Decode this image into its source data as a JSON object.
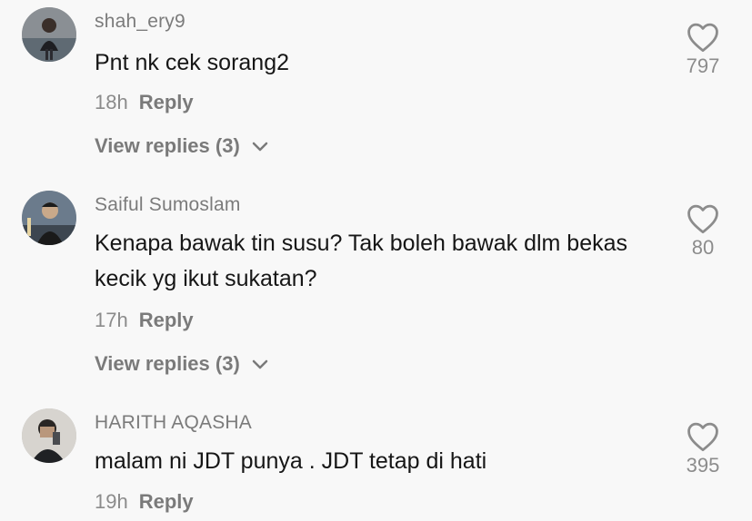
{
  "comments": [
    {
      "username": "shah_ery9",
      "text": "Pnt nk cek sorang2",
      "time": "18h",
      "reply_label": "Reply",
      "view_replies": "View replies (3)",
      "likes": "797",
      "avatar_icon": "user-avatar"
    },
    {
      "username": "Saiful Sumoslam",
      "text": "Kenapa bawak tin susu? Tak boleh bawak dlm bekas kecik yg ikut sukatan?",
      "time": "17h",
      "reply_label": "Reply",
      "view_replies": "View replies (3)",
      "likes": "80",
      "avatar_icon": "user-avatar"
    },
    {
      "username": "HARITH AQASHA",
      "text": "malam ni JDT punya . JDT tetap di hati",
      "time": "19h",
      "reply_label": "Reply",
      "likes": "395",
      "avatar_icon": "user-avatar"
    }
  ],
  "icons": {
    "like": "heart-outline-icon",
    "expand": "chevron-down-icon"
  },
  "colors": {
    "background": "#f8f8f8",
    "text": "#161616",
    "muted": "#8b8b8b"
  }
}
